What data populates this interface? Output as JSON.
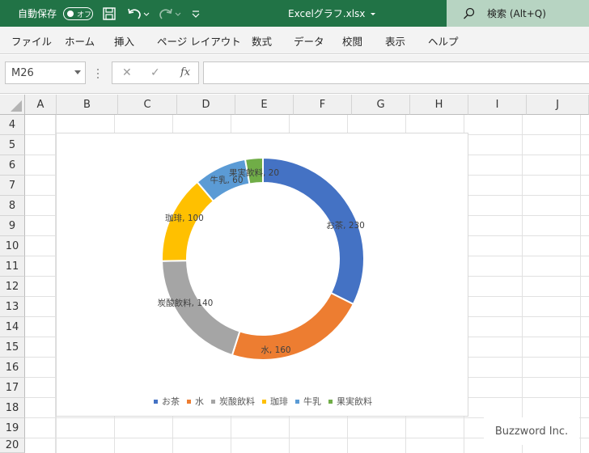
{
  "titlebar": {
    "autosave_label": "自動保存",
    "autosave_state": "オフ",
    "file_name": "Excelグラフ.xlsx",
    "search_label": "検索 (Alt+Q)"
  },
  "ribbon": {
    "tabs": [
      "ファイル",
      "ホーム",
      "挿入",
      "ページ レイアウト",
      "数式",
      "データ",
      "校閲",
      "表示",
      "ヘルプ"
    ]
  },
  "formula_bar": {
    "name_box": "M26",
    "fx_label": "fx",
    "formula": ""
  },
  "grid": {
    "columns": [
      "A",
      "B",
      "C",
      "D",
      "E",
      "F",
      "G",
      "H",
      "I",
      "J"
    ],
    "rows": [
      "4",
      "5",
      "6",
      "7",
      "8",
      "9",
      "10",
      "11",
      "12",
      "13",
      "14",
      "15",
      "16",
      "17",
      "18",
      "19",
      "20"
    ]
  },
  "chart_data": {
    "type": "pie",
    "subtype": "doughnut",
    "categories": [
      "お茶",
      "水",
      "炭酸飲料",
      "珈琲",
      "牛乳",
      "果実飲料"
    ],
    "values": [
      230,
      160,
      140,
      100,
      60,
      20
    ],
    "data_labels": [
      "お茶, 230",
      "水, 160",
      "炭酸飲料, 140",
      "珈琲, 100",
      "牛乳, 60",
      "果実飲料, 20"
    ],
    "colors": [
      "#4472C4",
      "#ED7D31",
      "#A5A5A5",
      "#FFC000",
      "#5B9BD5",
      "#70AD47"
    ],
    "legend_position": "bottom"
  },
  "watermark": "Buzzword Inc."
}
